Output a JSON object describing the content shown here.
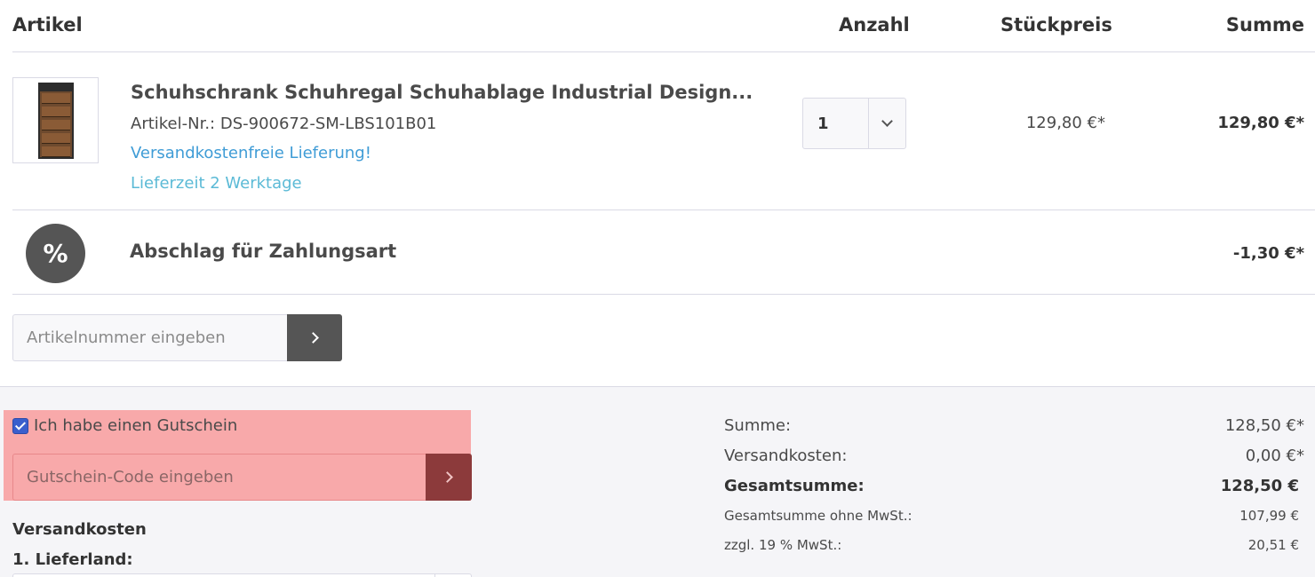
{
  "header": {
    "artikel": "Artikel",
    "anzahl": "Anzahl",
    "stueckpreis": "Stückpreis",
    "summe": "Summe"
  },
  "product": {
    "title": "Schuhschrank Schuhregal Schuhablage Industrial Design...",
    "article_number": "Artikel-Nr.: DS-900672-SM-LBS101B01",
    "shipping_note": "Versandkostenfreie Lieferung!",
    "delivery_time": "Lieferzeit 2 Werktage",
    "quantity": "1",
    "unit_price": "129,80 €*",
    "row_total": "129,80 €*"
  },
  "discount": {
    "icon": "%",
    "label": "Abschlag für Zahlungsart",
    "value": "-1,30 €*"
  },
  "article_add": {
    "placeholder": "Artikelnummer eingeben"
  },
  "voucher": {
    "checkbox_label": "Ich habe einen Gutschein",
    "checked": true,
    "placeholder": "Gutschein-Code eingeben",
    "highlight_color": "#f8a9aa"
  },
  "shipping": {
    "heading": "Versandkosten",
    "country_label": "1. Lieferland:"
  },
  "totals": {
    "sum_label": "Summe:",
    "sum_value": "128,50 €*",
    "shipping_label": "Versandkosten:",
    "shipping_value": "0,00 €*",
    "grand_label": "Gesamtsumme:",
    "grand_value": "128,50 €",
    "net_label": "Gesamtsumme ohne MwSt.:",
    "net_value": "107,99 €",
    "vat_label": "zzgl. 19 % MwSt.:",
    "vat_value": "20,51 €"
  },
  "colors": {
    "link_blue": "#3f9cd6",
    "delivery_teal": "#5bbad6",
    "dark_button": "#555555",
    "voucher_button": "#8c3a3b"
  }
}
